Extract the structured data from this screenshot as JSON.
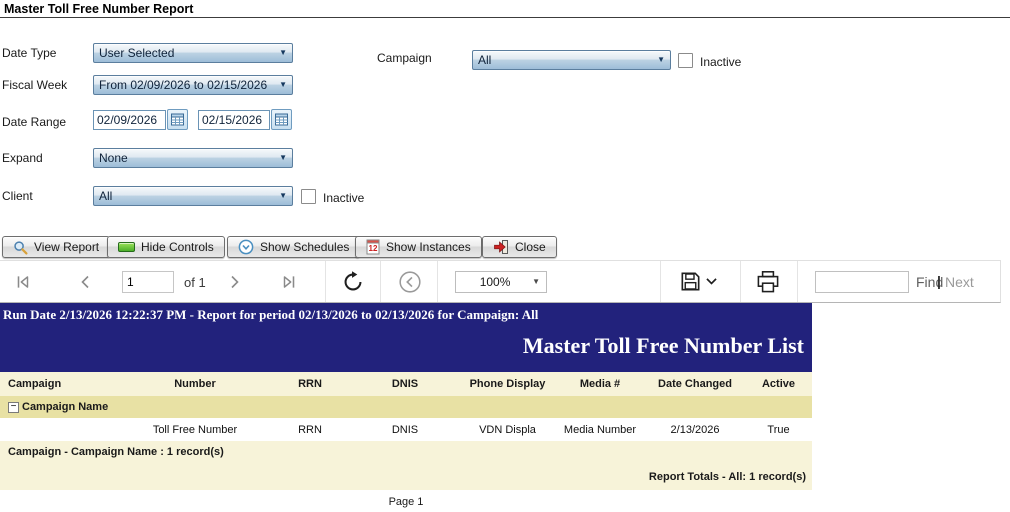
{
  "page": {
    "title": "Master Toll Free Number Report"
  },
  "filters": {
    "date_type": {
      "label": "Date Type",
      "value": "User Selected"
    },
    "campaign": {
      "label": "Campaign",
      "value": "All",
      "inactive_label": "Inactive"
    },
    "fiscal_week": {
      "label": "Fiscal Week",
      "value": "From 02/09/2026 to 02/15/2026"
    },
    "date_range": {
      "label": "Date Range",
      "start": "02/09/2026",
      "end": "02/15/2026"
    },
    "expand": {
      "label": "Expand",
      "value": "None"
    },
    "client": {
      "label": "Client",
      "value": "All",
      "inactive_label": "Inactive"
    }
  },
  "actions": {
    "view_report": "View Report",
    "hide_controls": "Hide Controls",
    "show_schedules": "Show Schedules",
    "show_instances": "Show Instances",
    "close": "Close"
  },
  "toolbar": {
    "page_number": "1",
    "of_label": "of 1",
    "zoom_value": "100%",
    "find_label": "Find",
    "separator": "|",
    "next_label": "Next"
  },
  "report": {
    "run_line": "Run Date 2/13/2026 12:22:37 PM - Report for period 02/13/2026 to 02/13/2026 for Campaign: All",
    "title": "Master Toll Free Number List",
    "columns": [
      "Campaign",
      "Number",
      "RRN",
      "DNIS",
      "Phone Display",
      "Media #",
      "Date Changed",
      "Active"
    ],
    "group_label": "Campaign Name",
    "row": [
      "",
      "Toll Free Number",
      "RRN",
      "DNIS",
      "VDN Displa",
      "Media Number",
      "2/13/2026",
      "True"
    ],
    "group_footer": "Campaign - Campaign Name : 1 record(s)",
    "totals": "Report Totals - All: 1 record(s)",
    "page_label": "Page 1"
  },
  "icons": {
    "combo_arrow": "▼",
    "collapse_glyph": "−",
    "calendar_icon": "grid-calendar",
    "instances_number": "12"
  },
  "colors": {
    "navy": "#22227C",
    "cream": "#F7F3D9",
    "khaki": "#E8E1A4",
    "combo_blue": "#9DBDD8",
    "combo_border": "#5B7E9E"
  }
}
